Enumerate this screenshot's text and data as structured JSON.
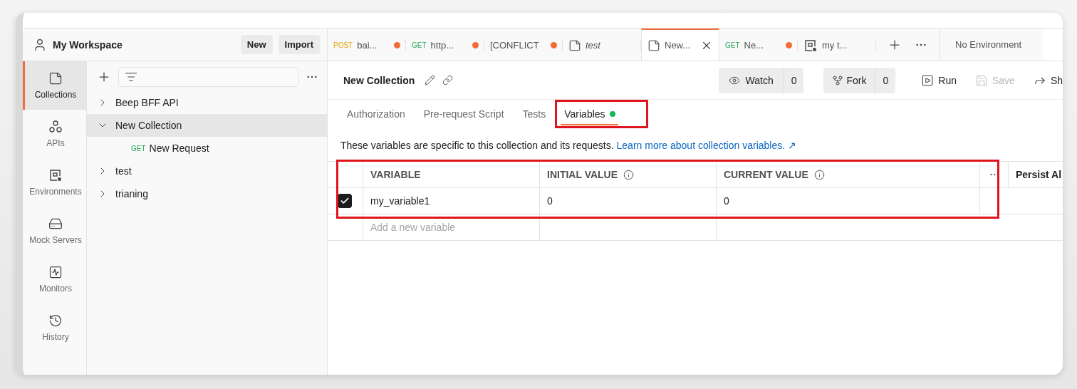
{
  "workspace": {
    "title": "My Workspace",
    "buttons": [
      "New",
      "Import"
    ]
  },
  "nav": [
    {
      "label": "Collections",
      "selected": true
    },
    {
      "label": "APIs",
      "selected": false
    },
    {
      "label": "Environments",
      "selected": false
    },
    {
      "label": "Mock Servers",
      "selected": false
    },
    {
      "label": "Monitors",
      "selected": false
    },
    {
      "label": "History",
      "selected": false
    }
  ],
  "tree": [
    {
      "label": "Beep BFF API",
      "expanded": false,
      "selected": false
    },
    {
      "label": "New Collection",
      "expanded": true,
      "selected": true,
      "children": [
        {
          "method": "GET",
          "color": "#23a455",
          "label": "New Request"
        }
      ]
    },
    {
      "label": "test",
      "expanded": false,
      "selected": false
    },
    {
      "label": "trianing",
      "expanded": false,
      "selected": false
    }
  ],
  "tabs": [
    {
      "kind": "request",
      "method": "POST",
      "color": "#e5a100",
      "label": "bai...",
      "unsaved": true,
      "selected": false
    },
    {
      "kind": "request",
      "method": "GET",
      "color": "#23a455",
      "label": "http...",
      "unsaved": true,
      "selected": false
    },
    {
      "kind": "text",
      "label": "[CONFLICT",
      "unsaved": true,
      "selected": false
    },
    {
      "kind": "collection",
      "label": "test",
      "unsaved": false,
      "selected": false
    },
    {
      "kind": "collection",
      "label": "New...",
      "unsaved": false,
      "selected": true
    },
    {
      "kind": "request",
      "method": "GET",
      "color": "#23a455",
      "label": "Ne...",
      "unsaved": true,
      "selected": false
    },
    {
      "kind": "environment",
      "label": "my t...",
      "unsaved": false,
      "selected": false
    }
  ],
  "environment": "No Environment",
  "collection": {
    "title": "New Collection",
    "watch": {
      "label": "Watch",
      "count": "0"
    },
    "fork": {
      "label": "Fork",
      "count": "0"
    },
    "run": "Run",
    "save": {
      "label": "Save",
      "disabled": true
    },
    "share": "Sh"
  },
  "subtabs": [
    {
      "label": "Authorization",
      "selected": false,
      "highlighted": false
    },
    {
      "label": "Pre-request Script",
      "selected": false,
      "highlighted": false
    },
    {
      "label": "Tests",
      "selected": false,
      "highlighted": false
    },
    {
      "label": "Variables",
      "selected": true,
      "highlighted": true,
      "has_values": true
    }
  ],
  "description": {
    "text": "These variables are specific to this collection and its requests.",
    "link": "Learn more about collection variables. ↗"
  },
  "table": {
    "highlighted": true,
    "columns": [
      {
        "label": "VARIABLE",
        "info": false
      },
      {
        "label": "INITIAL VALUE",
        "info": true
      },
      {
        "label": "CURRENT VALUE",
        "info": true
      }
    ],
    "extra_column": "Persist Al",
    "rows": [
      {
        "enabled": true,
        "cells": [
          "my_variable1",
          "0",
          "0"
        ]
      }
    ],
    "new_row_placeholder": "Add a new variable"
  }
}
